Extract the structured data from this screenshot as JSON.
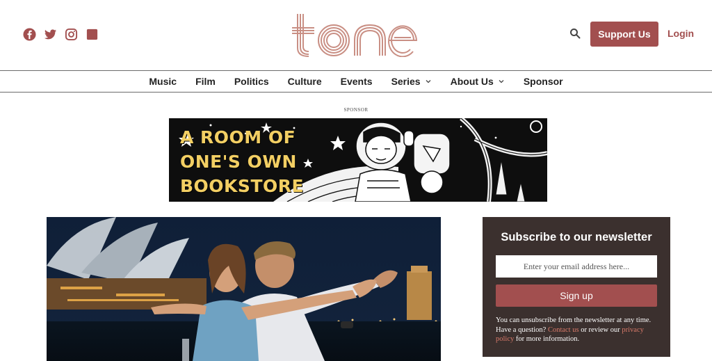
{
  "header": {
    "logo_text": "tone",
    "social_icons": [
      "facebook-icon",
      "twitter-icon",
      "instagram-icon",
      "square-icon"
    ],
    "support_label": "Support Us",
    "login_label": "Login",
    "brand_color": "#a24f4f"
  },
  "nav": {
    "items": [
      {
        "label": "Music",
        "has_dropdown": false
      },
      {
        "label": "Film",
        "has_dropdown": false
      },
      {
        "label": "Politics",
        "has_dropdown": false
      },
      {
        "label": "Culture",
        "has_dropdown": false
      },
      {
        "label": "Events",
        "has_dropdown": false
      },
      {
        "label": "Series",
        "has_dropdown": true
      },
      {
        "label": "About Us",
        "has_dropdown": true
      },
      {
        "label": "Sponsor",
        "has_dropdown": false
      }
    ]
  },
  "sponsor": {
    "label": "SPONSOR",
    "banner_lines": [
      "A ROOM OF",
      "ONE'S OWN",
      "BOOKSTORE"
    ]
  },
  "newsletter": {
    "title": "Subscribe to our newsletter",
    "email_placeholder": "Enter your email address here...",
    "signup_label": "Sign up",
    "text_1": "You can unsubscribe from the newsletter at any time. Have a question? ",
    "contact_link": "Contact us",
    "text_2": " or review our ",
    "privacy_link": "privacy policy",
    "text_3": " for more information."
  }
}
